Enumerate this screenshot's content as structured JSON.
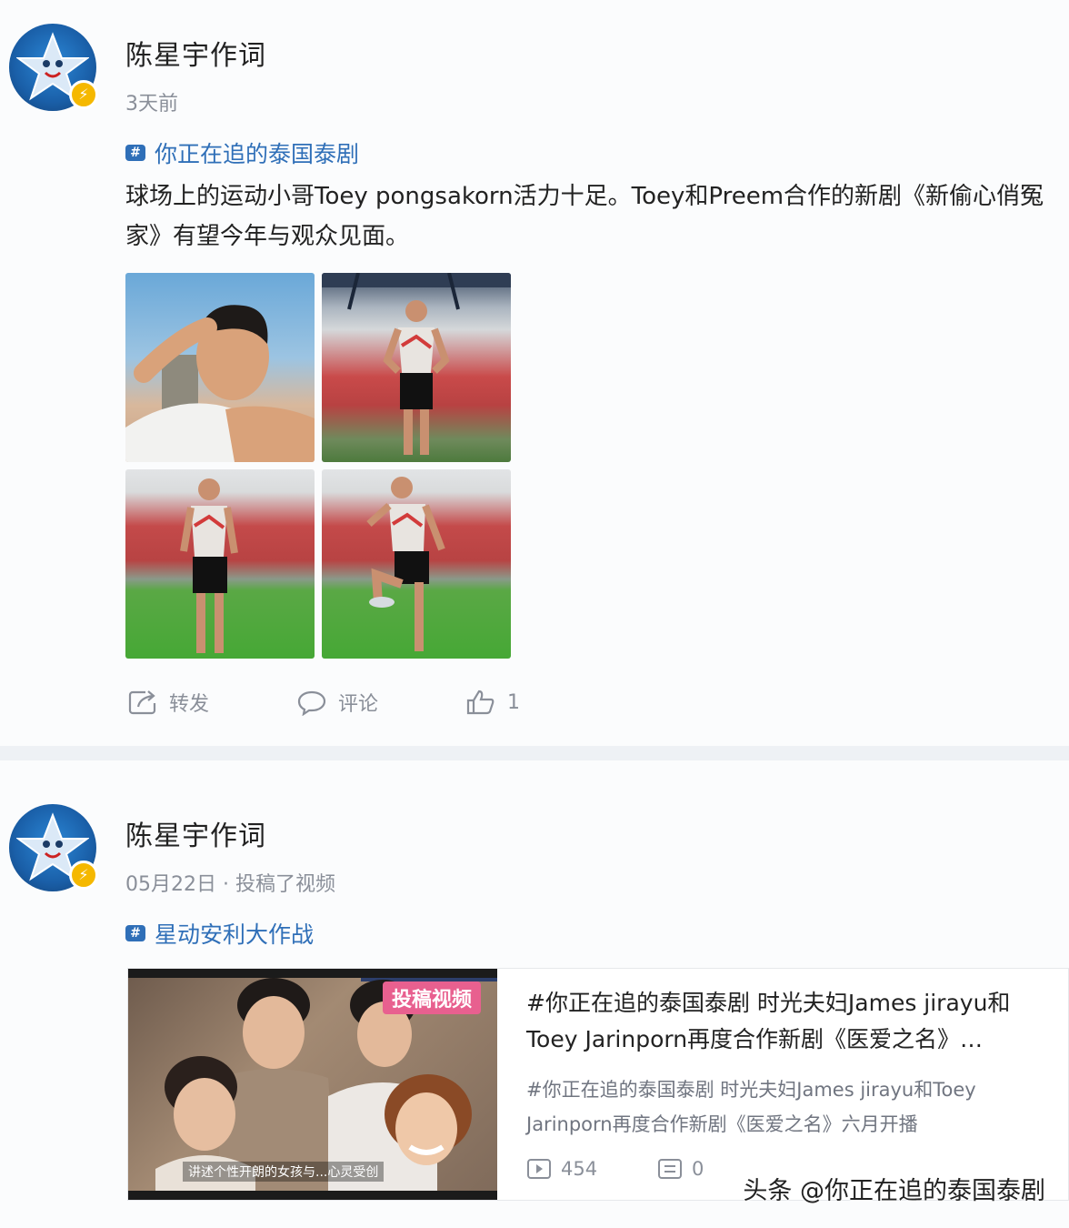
{
  "posts": [
    {
      "username": "陈星宇作词",
      "timestamp": "3天前",
      "topic": "你正在追的泰国泰剧",
      "content": "球场上的运动小哥Toey pongsakorn活力十足。Toey和Preem合作的新剧《新偷心俏冤家》有望今年与观众见面。",
      "actions": {
        "repost": "转发",
        "comment": "评论",
        "like_count": "1"
      }
    },
    {
      "username": "陈星宇作词",
      "timestamp": "05月22日",
      "timestamp_suffix": "· 投稿了视频",
      "topic": "星动安利大作战",
      "video_card": {
        "badge": "投稿视频",
        "thumb_caption": "讲述个性开朗的女孩与...心灵受创",
        "title": "#你正在追的泰国泰剧 时光夫妇James jirayu和Toey Jarinporn再度合作新剧《医爱之名》…",
        "description": "#你正在追的泰国泰剧 时光夫妇James jirayu和Toey Jarinporn再度合作新剧《医爱之名》六月开播",
        "plays": "454",
        "comments": "0"
      }
    }
  ],
  "watermark": "头条 @你正在追的泰国泰剧",
  "colors": {
    "link": "#2f6fb8",
    "muted": "#8a8f99",
    "badge": "#f5b800",
    "separator": "#eef1f5"
  },
  "icons": [
    "repost-icon",
    "comment-icon",
    "like-icon",
    "play-icon",
    "comment-count-icon",
    "topic-icon",
    "verified-icon"
  ]
}
